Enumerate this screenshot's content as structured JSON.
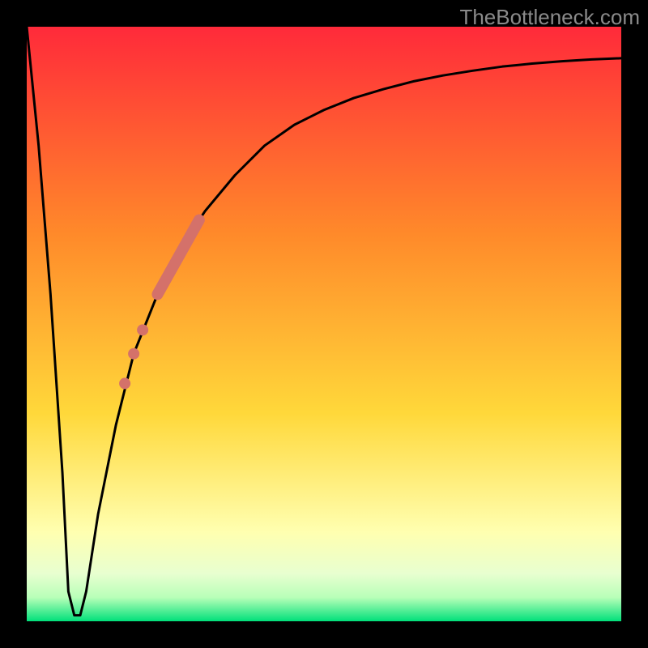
{
  "watermark": "TheBottleneck.com",
  "colors": {
    "frame": "#000000",
    "gradient_top": "#ff2a3a",
    "gradient_mid1": "#ff8a2a",
    "gradient_mid2": "#ffd83a",
    "gradient_pale": "#ffffb0",
    "gradient_green_light": "#b8ffb8",
    "gradient_green": "#00e07a",
    "curve": "#000000",
    "marker": "#d4716a"
  },
  "chart_data": {
    "type": "line",
    "title": "",
    "xlabel": "",
    "ylabel": "",
    "xlim": [
      0,
      100
    ],
    "ylim": [
      0,
      100
    ],
    "series": [
      {
        "name": "bottleneck-curve",
        "x": [
          0,
          2,
          4,
          6,
          7,
          8,
          9,
          10,
          12,
          15,
          18,
          22,
          26,
          30,
          35,
          40,
          45,
          50,
          55,
          60,
          65,
          70,
          75,
          80,
          85,
          90,
          95,
          100
        ],
        "values": [
          100,
          80,
          55,
          25,
          5,
          1,
          1,
          5,
          18,
          33,
          45,
          55,
          63,
          69,
          75,
          80,
          83.5,
          86,
          88,
          89.5,
          90.8,
          91.8,
          92.6,
          93.3,
          93.8,
          94.2,
          94.5,
          94.7
        ]
      }
    ],
    "markers": [
      {
        "name": "marker-segment",
        "type": "segment",
        "x": [
          22,
          29
        ],
        "y": [
          55,
          67.5
        ]
      },
      {
        "name": "marker-dot-1",
        "type": "dot",
        "x": 19.5,
        "y": 49
      },
      {
        "name": "marker-dot-2",
        "type": "dot",
        "x": 18.0,
        "y": 45
      },
      {
        "name": "marker-dot-3",
        "type": "dot",
        "x": 16.5,
        "y": 40
      }
    ],
    "gradient_stops": [
      {
        "offset": 0.0,
        "color": "#ff2a3a"
      },
      {
        "offset": 0.35,
        "color": "#ff8a2a"
      },
      {
        "offset": 0.65,
        "color": "#ffd83a"
      },
      {
        "offset": 0.85,
        "color": "#ffffb0"
      },
      {
        "offset": 0.92,
        "color": "#e8ffd0"
      },
      {
        "offset": 0.96,
        "color": "#b8ffb8"
      },
      {
        "offset": 1.0,
        "color": "#00e07a"
      }
    ]
  }
}
